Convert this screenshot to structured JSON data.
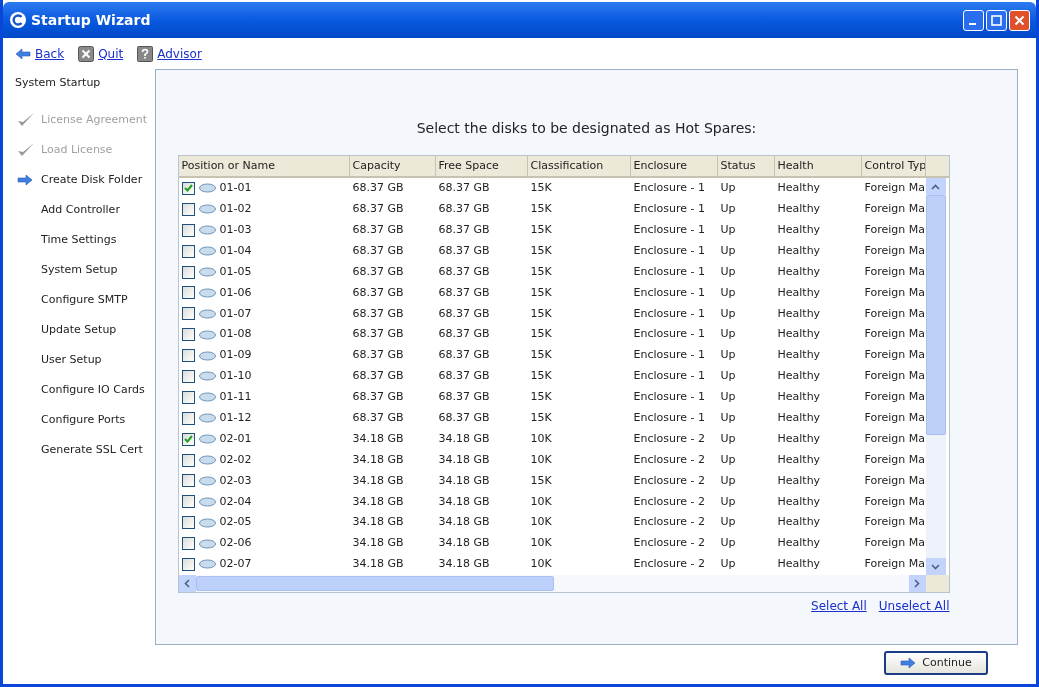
{
  "window": {
    "title": "Startup Wizard"
  },
  "toolbar": [
    {
      "kind": "back",
      "label": "Back"
    },
    {
      "kind": "quit",
      "label": "Quit"
    },
    {
      "kind": "help",
      "label": "Advisor"
    }
  ],
  "sidebar": {
    "heading": "System Startup",
    "items": [
      {
        "label": "License Agreement",
        "kind": "done"
      },
      {
        "label": "Load License",
        "kind": "done"
      },
      {
        "label": "Create Disk Folder",
        "kind": "current"
      },
      {
        "label": "Add Controller",
        "kind": "pending"
      },
      {
        "label": "Time Settings",
        "kind": "pending"
      },
      {
        "label": "System Setup",
        "kind": "pending"
      },
      {
        "label": "Configure SMTP",
        "kind": "pending"
      },
      {
        "label": "Update Setup",
        "kind": "pending"
      },
      {
        "label": "User Setup",
        "kind": "pending"
      },
      {
        "label": "Configure IO Cards",
        "kind": "pending"
      },
      {
        "label": "Configure Ports",
        "kind": "pending"
      },
      {
        "label": "Generate SSL Cert",
        "kind": "pending"
      }
    ]
  },
  "prompt": "Select the disks to be designated as Hot Spares:",
  "table": {
    "columns": [
      "Position or Name",
      "Capacity",
      "Free Space",
      "Classification",
      "Enclosure",
      "Status",
      "Health",
      "Control Typ"
    ],
    "rows": [
      {
        "checked": true,
        "cells": [
          "01-01",
          "68.37 GB",
          "68.37 GB",
          "15K",
          "Enclosure - 1",
          "Up",
          "Healthy",
          "Foreign Ma"
        ]
      },
      {
        "checked": false,
        "cells": [
          "01-02",
          "68.37 GB",
          "68.37 GB",
          "15K",
          "Enclosure - 1",
          "Up",
          "Healthy",
          "Foreign Ma"
        ]
      },
      {
        "checked": false,
        "cells": [
          "01-03",
          "68.37 GB",
          "68.37 GB",
          "15K",
          "Enclosure - 1",
          "Up",
          "Healthy",
          "Foreign Ma"
        ]
      },
      {
        "checked": false,
        "cells": [
          "01-04",
          "68.37 GB",
          "68.37 GB",
          "15K",
          "Enclosure - 1",
          "Up",
          "Healthy",
          "Foreign Ma"
        ]
      },
      {
        "checked": false,
        "cells": [
          "01-05",
          "68.37 GB",
          "68.37 GB",
          "15K",
          "Enclosure - 1",
          "Up",
          "Healthy",
          "Foreign Ma"
        ]
      },
      {
        "checked": false,
        "cells": [
          "01-06",
          "68.37 GB",
          "68.37 GB",
          "15K",
          "Enclosure - 1",
          "Up",
          "Healthy",
          "Foreign Ma"
        ]
      },
      {
        "checked": false,
        "cells": [
          "01-07",
          "68.37 GB",
          "68.37 GB",
          "15K",
          "Enclosure - 1",
          "Up",
          "Healthy",
          "Foreign Ma"
        ]
      },
      {
        "checked": false,
        "cells": [
          "01-08",
          "68.37 GB",
          "68.37 GB",
          "15K",
          "Enclosure - 1",
          "Up",
          "Healthy",
          "Foreign Ma"
        ]
      },
      {
        "checked": false,
        "cells": [
          "01-09",
          "68.37 GB",
          "68.37 GB",
          "15K",
          "Enclosure - 1",
          "Up",
          "Healthy",
          "Foreign Ma"
        ]
      },
      {
        "checked": false,
        "cells": [
          "01-10",
          "68.37 GB",
          "68.37 GB",
          "15K",
          "Enclosure - 1",
          "Up",
          "Healthy",
          "Foreign Ma"
        ]
      },
      {
        "checked": false,
        "cells": [
          "01-11",
          "68.37 GB",
          "68.37 GB",
          "15K",
          "Enclosure - 1",
          "Up",
          "Healthy",
          "Foreign Ma"
        ]
      },
      {
        "checked": false,
        "cells": [
          "01-12",
          "68.37 GB",
          "68.37 GB",
          "15K",
          "Enclosure - 1",
          "Up",
          "Healthy",
          "Foreign Ma"
        ]
      },
      {
        "checked": true,
        "cells": [
          "02-01",
          "34.18 GB",
          "34.18 GB",
          "10K",
          "Enclosure - 2",
          "Up",
          "Healthy",
          "Foreign Ma"
        ]
      },
      {
        "checked": false,
        "cells": [
          "02-02",
          "34.18 GB",
          "34.18 GB",
          "10K",
          "Enclosure - 2",
          "Up",
          "Healthy",
          "Foreign Ma"
        ]
      },
      {
        "checked": false,
        "cells": [
          "02-03",
          "34.18 GB",
          "34.18 GB",
          "15K",
          "Enclosure - 2",
          "Up",
          "Healthy",
          "Foreign Ma"
        ]
      },
      {
        "checked": false,
        "cells": [
          "02-04",
          "34.18 GB",
          "34.18 GB",
          "10K",
          "Enclosure - 2",
          "Up",
          "Healthy",
          "Foreign Ma"
        ]
      },
      {
        "checked": false,
        "cells": [
          "02-05",
          "34.18 GB",
          "34.18 GB",
          "10K",
          "Enclosure - 2",
          "Up",
          "Healthy",
          "Foreign Ma"
        ]
      },
      {
        "checked": false,
        "cells": [
          "02-06",
          "34.18 GB",
          "34.18 GB",
          "10K",
          "Enclosure - 2",
          "Up",
          "Healthy",
          "Foreign Ma"
        ]
      },
      {
        "checked": false,
        "cells": [
          "02-07",
          "34.18 GB",
          "34.18 GB",
          "10K",
          "Enclosure - 2",
          "Up",
          "Healthy",
          "Foreign Ma"
        ]
      }
    ]
  },
  "links": [
    "Select All",
    "Unselect All"
  ],
  "continue_button": "Continue"
}
